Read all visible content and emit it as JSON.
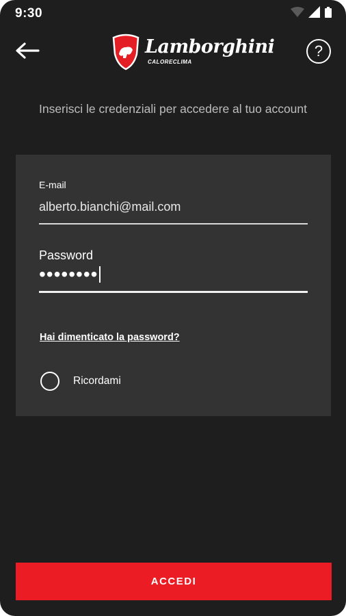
{
  "status_bar": {
    "time": "9:30",
    "icons": [
      "wifi-icon",
      "signal-icon",
      "battery-icon"
    ]
  },
  "app_bar": {
    "back_icon": "arrow-left-icon",
    "brand_name": "Lamborghini",
    "brand_sub": "CALORECLIMA",
    "help_label": "?"
  },
  "intro_text": "Inserisci le credenziali per accedere al tuo account",
  "form": {
    "email_label": "E-mail",
    "email_value": "alberto.bianchi@mail.com",
    "password_label": "Password",
    "password_masked": "••••••••",
    "forgot_password": "Hai dimenticato la password?",
    "remember_label": "Ricordami",
    "remember_checked": false
  },
  "submit_label": "ACCEDI",
  "colors": {
    "background": "#1e1e1e",
    "card": "#333333",
    "accent": "#ec1c24",
    "text": "#ffffff"
  }
}
